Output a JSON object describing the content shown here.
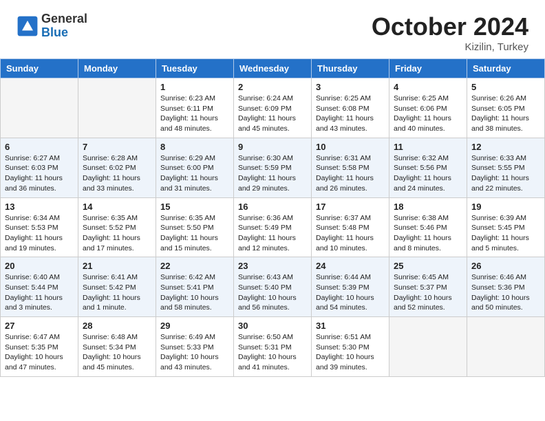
{
  "header": {
    "logo_general": "General",
    "logo_blue": "Blue",
    "title": "October 2024",
    "location": "Kizilin, Turkey"
  },
  "weekdays": [
    "Sunday",
    "Monday",
    "Tuesday",
    "Wednesday",
    "Thursday",
    "Friday",
    "Saturday"
  ],
  "weeks": [
    [
      {
        "day": "",
        "info": ""
      },
      {
        "day": "",
        "info": ""
      },
      {
        "day": "1",
        "sunrise": "6:23 AM",
        "sunset": "6:11 PM",
        "daylight": "11 hours and 48 minutes."
      },
      {
        "day": "2",
        "sunrise": "6:24 AM",
        "sunset": "6:09 PM",
        "daylight": "11 hours and 45 minutes."
      },
      {
        "day": "3",
        "sunrise": "6:25 AM",
        "sunset": "6:08 PM",
        "daylight": "11 hours and 43 minutes."
      },
      {
        "day": "4",
        "sunrise": "6:25 AM",
        "sunset": "6:06 PM",
        "daylight": "11 hours and 40 minutes."
      },
      {
        "day": "5",
        "sunrise": "6:26 AM",
        "sunset": "6:05 PM",
        "daylight": "11 hours and 38 minutes."
      }
    ],
    [
      {
        "day": "6",
        "sunrise": "6:27 AM",
        "sunset": "6:03 PM",
        "daylight": "11 hours and 36 minutes."
      },
      {
        "day": "7",
        "sunrise": "6:28 AM",
        "sunset": "6:02 PM",
        "daylight": "11 hours and 33 minutes."
      },
      {
        "day": "8",
        "sunrise": "6:29 AM",
        "sunset": "6:00 PM",
        "daylight": "11 hours and 31 minutes."
      },
      {
        "day": "9",
        "sunrise": "6:30 AM",
        "sunset": "5:59 PM",
        "daylight": "11 hours and 29 minutes."
      },
      {
        "day": "10",
        "sunrise": "6:31 AM",
        "sunset": "5:58 PM",
        "daylight": "11 hours and 26 minutes."
      },
      {
        "day": "11",
        "sunrise": "6:32 AM",
        "sunset": "5:56 PM",
        "daylight": "11 hours and 24 minutes."
      },
      {
        "day": "12",
        "sunrise": "6:33 AM",
        "sunset": "5:55 PM",
        "daylight": "11 hours and 22 minutes."
      }
    ],
    [
      {
        "day": "13",
        "sunrise": "6:34 AM",
        "sunset": "5:53 PM",
        "daylight": "11 hours and 19 minutes."
      },
      {
        "day": "14",
        "sunrise": "6:35 AM",
        "sunset": "5:52 PM",
        "daylight": "11 hours and 17 minutes."
      },
      {
        "day": "15",
        "sunrise": "6:35 AM",
        "sunset": "5:50 PM",
        "daylight": "11 hours and 15 minutes."
      },
      {
        "day": "16",
        "sunrise": "6:36 AM",
        "sunset": "5:49 PM",
        "daylight": "11 hours and 12 minutes."
      },
      {
        "day": "17",
        "sunrise": "6:37 AM",
        "sunset": "5:48 PM",
        "daylight": "11 hours and 10 minutes."
      },
      {
        "day": "18",
        "sunrise": "6:38 AM",
        "sunset": "5:46 PM",
        "daylight": "11 hours and 8 minutes."
      },
      {
        "day": "19",
        "sunrise": "6:39 AM",
        "sunset": "5:45 PM",
        "daylight": "11 hours and 5 minutes."
      }
    ],
    [
      {
        "day": "20",
        "sunrise": "6:40 AM",
        "sunset": "5:44 PM",
        "daylight": "11 hours and 3 minutes."
      },
      {
        "day": "21",
        "sunrise": "6:41 AM",
        "sunset": "5:42 PM",
        "daylight": "11 hours and 1 minute."
      },
      {
        "day": "22",
        "sunrise": "6:42 AM",
        "sunset": "5:41 PM",
        "daylight": "10 hours and 58 minutes."
      },
      {
        "day": "23",
        "sunrise": "6:43 AM",
        "sunset": "5:40 PM",
        "daylight": "10 hours and 56 minutes."
      },
      {
        "day": "24",
        "sunrise": "6:44 AM",
        "sunset": "5:39 PM",
        "daylight": "10 hours and 54 minutes."
      },
      {
        "day": "25",
        "sunrise": "6:45 AM",
        "sunset": "5:37 PM",
        "daylight": "10 hours and 52 minutes."
      },
      {
        "day": "26",
        "sunrise": "6:46 AM",
        "sunset": "5:36 PM",
        "daylight": "10 hours and 50 minutes."
      }
    ],
    [
      {
        "day": "27",
        "sunrise": "6:47 AM",
        "sunset": "5:35 PM",
        "daylight": "10 hours and 47 minutes."
      },
      {
        "day": "28",
        "sunrise": "6:48 AM",
        "sunset": "5:34 PM",
        "daylight": "10 hours and 45 minutes."
      },
      {
        "day": "29",
        "sunrise": "6:49 AM",
        "sunset": "5:33 PM",
        "daylight": "10 hours and 43 minutes."
      },
      {
        "day": "30",
        "sunrise": "6:50 AM",
        "sunset": "5:31 PM",
        "daylight": "10 hours and 41 minutes."
      },
      {
        "day": "31",
        "sunrise": "6:51 AM",
        "sunset": "5:30 PM",
        "daylight": "10 hours and 39 minutes."
      },
      {
        "day": "",
        "info": ""
      },
      {
        "day": "",
        "info": ""
      }
    ]
  ]
}
